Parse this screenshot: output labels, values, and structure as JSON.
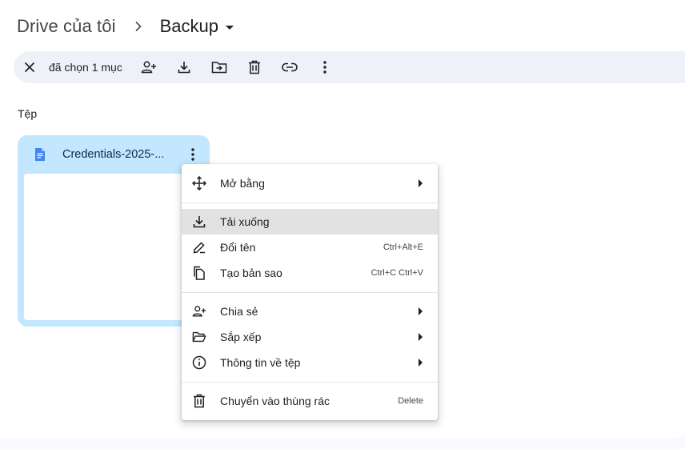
{
  "breadcrumb": {
    "root": "Drive của tôi",
    "current": "Backup"
  },
  "selection_toolbar": {
    "count_label": "đã chọn 1 mục",
    "icons": [
      "close-icon",
      "share-person-icon",
      "download-icon",
      "move-to-folder-icon",
      "trash-icon",
      "link-icon",
      "more-vertical-icon"
    ]
  },
  "section": {
    "files_label": "Tệp"
  },
  "file_card": {
    "name": "Credentials-2025-...",
    "icon": "google-docs-icon",
    "icon_color": "#4285f4",
    "background": "#c2e7ff"
  },
  "context_menu": {
    "items": [
      {
        "label": "Mở bằng",
        "icon": "open-with-icon",
        "shortcut": "",
        "submenu": true
      },
      {
        "label": "Tải xuống",
        "icon": "download-icon",
        "shortcut": "",
        "submenu": false,
        "highlighted": true
      },
      {
        "label": "Đổi tên",
        "icon": "rename-pen-icon",
        "shortcut": "Ctrl+Alt+E",
        "submenu": false
      },
      {
        "label": "Tạo bản sao",
        "icon": "copy-icon",
        "shortcut": "Ctrl+C Ctrl+V",
        "submenu": false
      },
      {
        "label": "Chia sẻ",
        "icon": "share-person-icon",
        "shortcut": "",
        "submenu": true
      },
      {
        "label": "Sắp xếp",
        "icon": "folder-open-icon",
        "shortcut": "",
        "submenu": true
      },
      {
        "label": "Thông tin về tệp",
        "icon": "info-icon",
        "shortcut": "",
        "submenu": true
      },
      {
        "label": "Chuyển vào thùng rác",
        "icon": "trash-icon",
        "shortcut": "Delete",
        "submenu": false
      }
    ]
  }
}
